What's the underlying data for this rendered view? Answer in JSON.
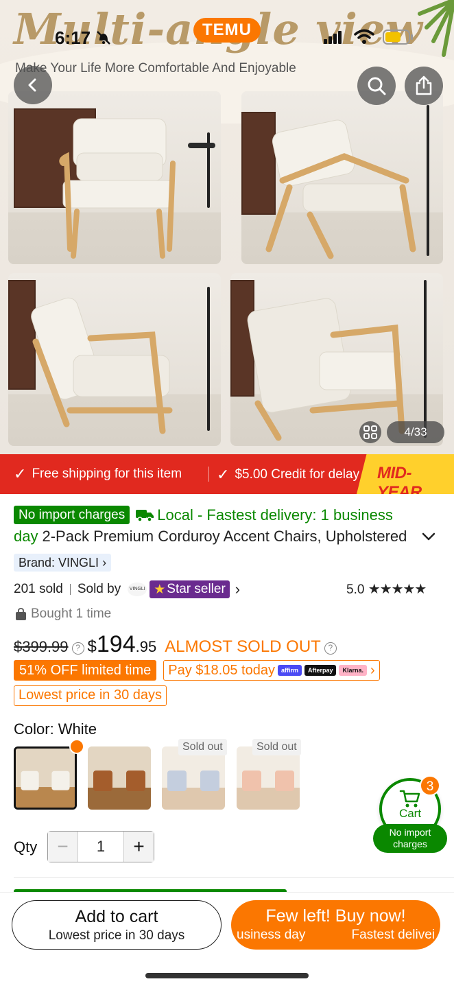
{
  "status_bar": {
    "time": "6:17"
  },
  "hero": {
    "title": "Multi-angle view",
    "subtitle": "Make Your Life More Comfortable And Enjoyable",
    "badge": "TEMU",
    "page_counter": "4/33"
  },
  "ship_banner": {
    "free_shipping": "Free shipping for this item",
    "credit": "$5.00 Credit for delay",
    "promo": "MID-YEAR"
  },
  "product": {
    "no_import_badge": "No import charges",
    "local_delivery": "Local - Fastest delivery: 1 business",
    "local_delivery_cont": "day",
    "title": "2-Pack Premium Corduroy Accent Chairs, Upholstered",
    "brand": "Brand: VINGLI",
    "sold_count": "201 sold",
    "sold_by": "Sold by",
    "seller_logo": "VINGLI",
    "star_seller": "Star seller",
    "rating": "5.0",
    "rating_stars": "★★★★★",
    "bought": "Bought 1 time"
  },
  "price": {
    "original": "$399.99",
    "currency": "$",
    "integer": "194",
    "decimal": ".95",
    "stock_note": "ALMOST SOLD OUT",
    "discount": "51% OFF limited time",
    "pay_today": "Pay $18.05 today",
    "pay_logos": [
      "affirm",
      "Afterpay",
      "Klarna."
    ],
    "lowest": "Lowest price in 30 days"
  },
  "color": {
    "label": "Color: White",
    "swatches": [
      {
        "name": "White",
        "sold_out": false,
        "selected": true
      },
      {
        "name": "Brown",
        "sold_out": false,
        "selected": false
      },
      {
        "name": "Blue",
        "sold_out": true,
        "selected": false,
        "tag": "Sold out"
      },
      {
        "name": "Orange",
        "sold_out": true,
        "selected": false,
        "tag": "Sold out"
      }
    ]
  },
  "qty": {
    "label": "Qty",
    "value": "1",
    "minus": "−",
    "plus": "+"
  },
  "cart_float": {
    "label": "Cart",
    "count": "3",
    "note": "No import charges"
  },
  "bottom": {
    "add_to_cart": "Add to cart",
    "add_to_cart_sub": "Lowest price in 30 days",
    "buy_now": "Few left! Buy now!",
    "buy_now_sub_left": "usiness day",
    "buy_now_sub_right": "Fastest delivei"
  },
  "colors": {
    "temu_orange": "#fb7701",
    "green": "#0a8800",
    "banner_red": "#e1291f",
    "star_purple": "#6a2b8f"
  }
}
